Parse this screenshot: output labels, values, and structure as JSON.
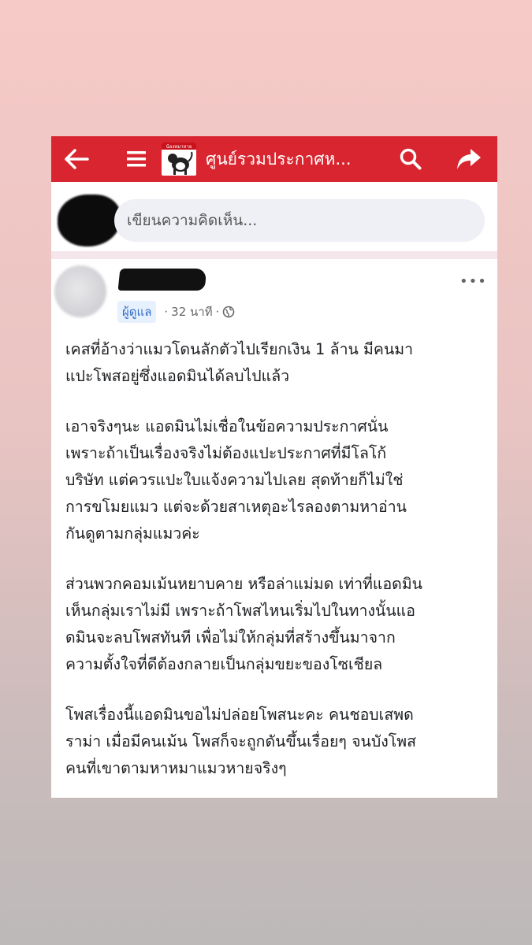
{
  "topbar": {
    "title": "ศูนย์รวมประกาศห...",
    "logo_caption": "น้องหมาหาย",
    "back_icon": "arrow-left-icon",
    "menu_icon": "hamburger-menu-icon",
    "search_icon": "search-icon",
    "share_icon": "share-arrow-icon",
    "bg_color": "#d8252f"
  },
  "comment": {
    "placeholder": "เขียนความคิดเห็น..."
  },
  "post": {
    "badge": "ผู้ดูแล",
    "time": "32 นาที",
    "separator": "·",
    "privacy_icon": "globe-icon",
    "paragraphs": [
      [
        "เคสที่อ้างว่าแมวโดนลักตัวไปเรียกเงิน 1 ล้าน มีคนมา",
        "แปะโพสอยู่ซึ่งแอดมินได้ลบไปแล้ว"
      ],
      [
        "เอาจริงๆนะ แอดมินไม่เชื่อในข้อความประกาศนั่น",
        "เพราะถ้าเป็นเรื่องจริงไม่ต้องแปะประกาศที่มีโลโก้",
        "บริษัท แต่ควรแปะใบแจ้งความไปเลย สุดท้ายก็ไม่ใช่",
        "การขโมยแมว แต่จะด้วยสาเหตุอะไรลองตามหาอ่าน",
        "กันดูตามกลุ่มแมวค่ะ"
      ],
      [
        "ส่วนพวกคอมเม้นหยาบคาย หรือล่าแม่มด เท่าที่แอดมิน",
        "เห็นกลุ่มเราไม่มี เพราะถ้าโพสไหนเริ่มไปในทางนั้นแอ",
        "ดมินจะลบโพสทันที เพื่อไม่ให้กลุ่มที่สร้างขึ้นมาจาก",
        "ความตั้งใจที่ดีต้องกลายเป็นกลุ่มขยะของโซเชียล"
      ],
      [
        "โพสเรื่องนี้แอดมินขอไม่ปล่อยโพสนะคะ คนชอบเสพด",
        "ราม่า เมื่อมีคนเม้น โพสก็จะถูกดันขึ้นเรื่อยๆ จนบังโพส",
        "คนที่เขาตามหาหมาแมวหายจริงๆ"
      ]
    ]
  }
}
